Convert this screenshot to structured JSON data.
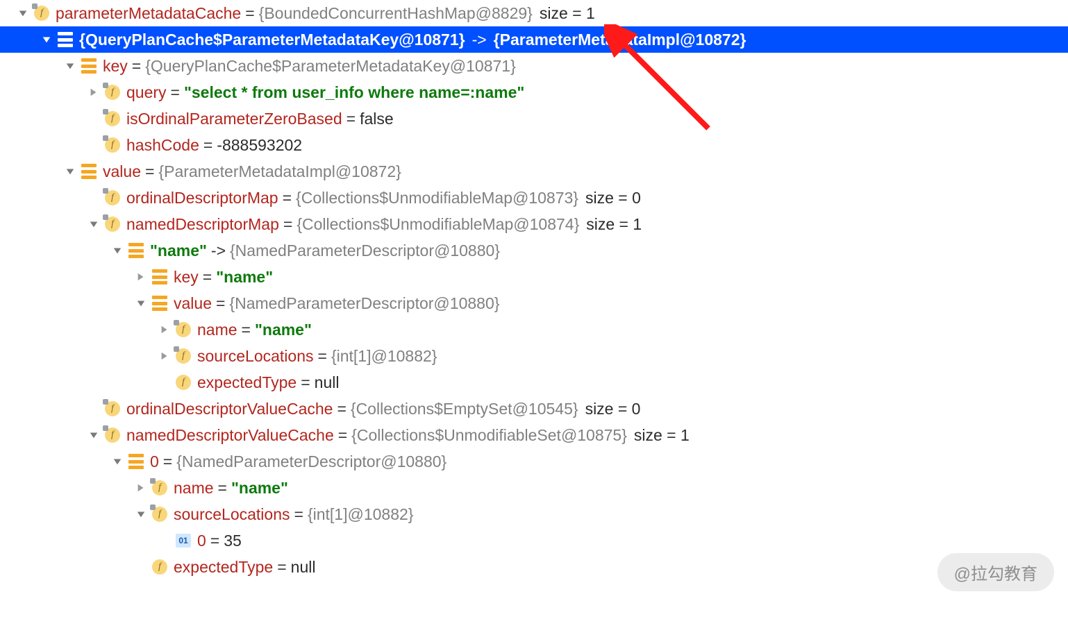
{
  "rows": [
    {
      "indent": 24,
      "arrow": "down",
      "icon": "field-pin",
      "name": "parameterMetadataCache",
      "eq": " = ",
      "ref": "{BoundedConcurrentHashMap@8829}",
      "annot": "size = 1"
    },
    {
      "indent": 58,
      "arrow": "down-white",
      "icon": "map-white",
      "selected": true,
      "selLeft": "{QueryPlanCache$ParameterMetadataKey@10871}",
      "selArrow": " -> ",
      "selRight": "{ParameterMetadataImpl@10872}"
    },
    {
      "indent": 92,
      "arrow": "down",
      "icon": "map",
      "name": "key",
      "eq": " = ",
      "ref": "{QueryPlanCache$ParameterMetadataKey@10871}"
    },
    {
      "indent": 126,
      "arrow": "right",
      "icon": "field-pin",
      "name": "query",
      "eq": " = ",
      "str": "\"select * from user_info where name=:name\""
    },
    {
      "indent": 126,
      "arrow": "blank",
      "icon": "field-pin",
      "name": "isOrdinalParameterZeroBased",
      "eq": " = ",
      "val": "false"
    },
    {
      "indent": 126,
      "arrow": "blank",
      "icon": "field-pin",
      "name": "hashCode",
      "eq": " = ",
      "val": "-888593202"
    },
    {
      "indent": 92,
      "arrow": "down",
      "icon": "map",
      "name": "value",
      "eq": " = ",
      "ref": "{ParameterMetadataImpl@10872}"
    },
    {
      "indent": 126,
      "arrow": "blank",
      "icon": "field-pin",
      "name": "ordinalDescriptorMap",
      "eq": " = ",
      "ref": "{Collections$UnmodifiableMap@10873}",
      "annot": "size = 0"
    },
    {
      "indent": 126,
      "arrow": "down",
      "icon": "field-pin",
      "name": "namedDescriptorMap",
      "eq": " = ",
      "ref": "{Collections$UnmodifiableMap@10874}",
      "annot": "size = 1"
    },
    {
      "indent": 160,
      "arrow": "down",
      "icon": "map",
      "str": "\"name\"",
      "eq": " -> ",
      "ref": "{NamedParameterDescriptor@10880}"
    },
    {
      "indent": 194,
      "arrow": "right",
      "icon": "map",
      "name": "key",
      "eq": " = ",
      "str": "\"name\""
    },
    {
      "indent": 194,
      "arrow": "down",
      "icon": "map",
      "name": "value",
      "eq": " = ",
      "ref": "{NamedParameterDescriptor@10880}"
    },
    {
      "indent": 228,
      "arrow": "right",
      "icon": "field-pin",
      "name": "name",
      "eq": " = ",
      "str": "\"name\""
    },
    {
      "indent": 228,
      "arrow": "right",
      "icon": "field-pin",
      "name": "sourceLocations",
      "eq": " = ",
      "ref": "{int[1]@10882}"
    },
    {
      "indent": 228,
      "arrow": "blank",
      "icon": "field",
      "name": "expectedType",
      "eq": " = ",
      "val": "null"
    },
    {
      "indent": 126,
      "arrow": "blank",
      "icon": "field-pin",
      "name": "ordinalDescriptorValueCache",
      "eq": " = ",
      "ref": "{Collections$EmptySet@10545}",
      "annot": "size = 0"
    },
    {
      "indent": 126,
      "arrow": "down",
      "icon": "field-pin",
      "name": "namedDescriptorValueCache",
      "eq": " = ",
      "ref": "{Collections$UnmodifiableSet@10875}",
      "annot": "size = 1"
    },
    {
      "indent": 160,
      "arrow": "down",
      "icon": "map",
      "name": "0",
      "eq": " = ",
      "ref": "{NamedParameterDescriptor@10880}"
    },
    {
      "indent": 194,
      "arrow": "right",
      "icon": "field-pin",
      "name": "name",
      "eq": " = ",
      "str": "\"name\""
    },
    {
      "indent": 194,
      "arrow": "down",
      "icon": "field-pin",
      "name": "sourceLocations",
      "eq": " = ",
      "ref": "{int[1]@10882}"
    },
    {
      "indent": 228,
      "arrow": "blank",
      "icon": "int",
      "name": "0",
      "eq": " = ",
      "val": "35"
    },
    {
      "indent": 194,
      "arrow": "blank",
      "icon": "field",
      "name": "expectedType",
      "eq": " = ",
      "val": "null"
    }
  ],
  "watermark": "@拉勾教育"
}
